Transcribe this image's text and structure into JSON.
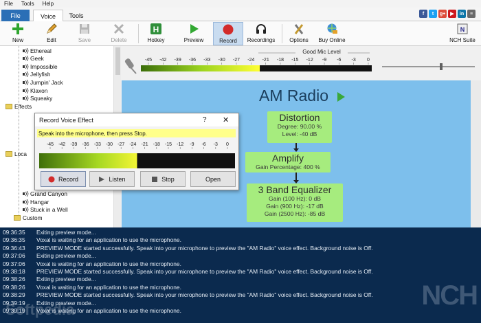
{
  "menu": [
    "File",
    "Tools",
    "Help"
  ],
  "tabs": {
    "file": "File",
    "voice": "Voice",
    "tools": "Tools"
  },
  "social": [
    {
      "name": "facebook-icon",
      "label": "f",
      "color": "#3b5998"
    },
    {
      "name": "twitter-icon",
      "label": "t",
      "color": "#1da1f2"
    },
    {
      "name": "google-plus-icon",
      "label": "g+",
      "color": "#dd4b39"
    },
    {
      "name": "youtube-icon",
      "label": "▶",
      "color": "#cc181e"
    },
    {
      "name": "linkedin-icon",
      "label": "in",
      "color": "#0e76a8"
    },
    {
      "name": "menu-icon",
      "label": "≡",
      "color": "#6a6a6a"
    }
  ],
  "toolbar": {
    "new": "New",
    "edit": "Edit",
    "save": "Save",
    "delete": "Delete",
    "hotkey": "Hotkey",
    "preview": "Preview",
    "record": "Record",
    "recordings": "Recordings",
    "options": "Options",
    "buy": "Buy Online",
    "suite": "NCH Suite"
  },
  "meter": {
    "title": "Good Mic Level",
    "ticks": [
      "-45",
      "-42",
      "-39",
      "-36",
      "-33",
      "-30",
      "-27",
      "-24",
      "-21",
      "-18",
      "-15",
      "-12",
      "-9",
      "-6",
      "-3",
      "0"
    ],
    "level": 0.5
  },
  "tree": {
    "items": [
      "Ethereal",
      "Geek",
      "Impossible",
      "Jellyfish",
      "Jumpin' Jack",
      "Klaxon",
      "Squeaky"
    ],
    "effects_folder": "Effects",
    "locations_folder": "Loca",
    "loc_items": [
      "Grand Canyon",
      "Hangar",
      "Stuck in a Well"
    ],
    "custom_folder": "Custom"
  },
  "effect": {
    "title": "AM Radio",
    "boxes": [
      {
        "name": "Distortion",
        "lines": [
          "Degree: 90.00 %",
          "Level: -40 dB"
        ]
      },
      {
        "name": "Amplify",
        "lines": [
          "Gain Percentage: 400 %"
        ]
      },
      {
        "name": "3 Band Equalizer",
        "lines": [
          "Gain (100 Hz): 0 dB",
          "Gain (900 Hz): -17 dB",
          "Gain (2500 Hz): -85 dB"
        ]
      }
    ]
  },
  "dialog": {
    "title": "Record Voice Effect",
    "help": "?",
    "close": "✕",
    "hint": "Speak into the microphone, then press Stop.",
    "ticks": [
      "-45",
      "-42",
      "-39",
      "-36",
      "-33",
      "-30",
      "-27",
      "-24",
      "-21",
      "-18",
      "-15",
      "-12",
      "-9",
      "-6",
      "-3",
      "0"
    ],
    "level": 0.5,
    "record": "Record",
    "listen": "Listen",
    "stop": "Stop",
    "open": "Open"
  },
  "log": [
    [
      "09:36:35",
      "Exiting preview mode..."
    ],
    [
      "09:36:35",
      "Voxal is waiting for an application to use the microphone."
    ],
    [
      "09:36:43",
      "PREVIEW MODE started successfully. Speak into your microphone to preview the \"AM Radio\" voice effect. Background noise is Off."
    ],
    [
      "09:37:06",
      "Exiting preview mode..."
    ],
    [
      "09:37:06",
      "Voxal is waiting for an application to use the microphone."
    ],
    [
      "09:38:18",
      "PREVIEW MODE started successfully. Speak into your microphone to preview the \"AM Radio\" voice effect. Background noise is Off."
    ],
    [
      "09:38:26",
      "Exiting preview mode..."
    ],
    [
      "09:38:26",
      "Voxal is waiting for an application to use the microphone."
    ],
    [
      "09:38:29",
      "PREVIEW MODE started successfully. Speak into your microphone to preview the \"AM Radio\" voice effect. Background noise is Off."
    ],
    [
      "09:39:19",
      "Exiting preview mode..."
    ],
    [
      "09:39:19",
      "Voxal is waiting for an application to use the microphone."
    ]
  ],
  "watermark": {
    "nch": "NCH",
    "softpedia": "Softpedia"
  }
}
